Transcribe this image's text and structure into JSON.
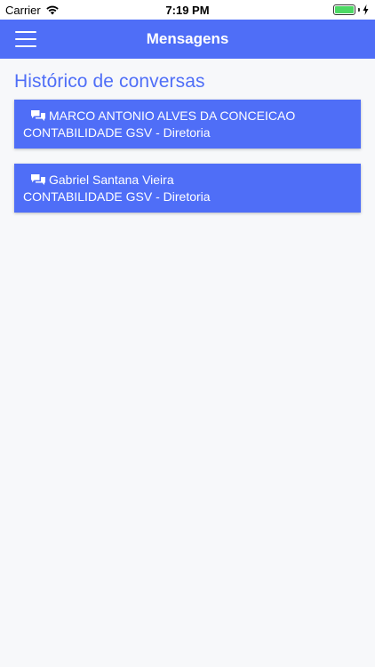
{
  "status_bar": {
    "carrier": "Carrier",
    "time": "7:19 PM"
  },
  "nav": {
    "title": "Mensagens",
    "menu_icon": "hamburger-menu-icon"
  },
  "page": {
    "title": "Histórico de conversas"
  },
  "conversations": [
    {
      "name": "MARCO ANTONIO ALVES DA CONCEICAO",
      "department": "CONTABILIDADE GSV - Diretoria",
      "icon": "chat-bubbles-icon"
    },
    {
      "name": "Gabriel Santana Vieira",
      "department": "CONTABILIDADE GSV - Diretoria",
      "icon": "chat-bubbles-icon"
    }
  ],
  "colors": {
    "primary": "#4f6ef7",
    "background": "#f7f8fa",
    "battery": "#4cd964"
  }
}
